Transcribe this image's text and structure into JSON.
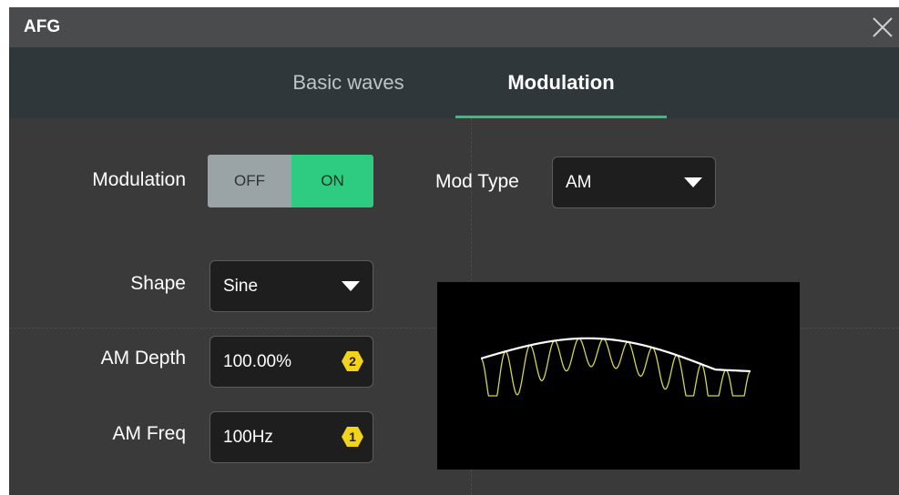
{
  "window": {
    "title": "AFG",
    "close_icon": "close-icon"
  },
  "tabs": [
    {
      "label": "Basic waves",
      "active": false
    },
    {
      "label": "Modulation",
      "active": true
    }
  ],
  "colors": {
    "accent": "#2ec27e",
    "toggle_on": "#2ecc80",
    "toggle_off": "#9aa3a5",
    "carrier_wave": "#d6d64a",
    "envelope": "#ffffff",
    "knob_badge": "#f2d21b"
  },
  "modulation": {
    "label": "Modulation",
    "off_label": "OFF",
    "on_label": "ON",
    "state": "ON"
  },
  "mod_type": {
    "label": "Mod Type",
    "value": "AM"
  },
  "shape": {
    "label": "Shape",
    "value": "Sine"
  },
  "am_depth": {
    "label": "AM Depth",
    "value": "100.00%",
    "knob": "2",
    "knob_icon": "knob-2-icon"
  },
  "am_freq": {
    "label": "AM Freq",
    "value": "100Hz",
    "knob": "1",
    "knob_icon": "knob-1-icon"
  },
  "preview": {
    "icon": "am-waveform-preview"
  }
}
